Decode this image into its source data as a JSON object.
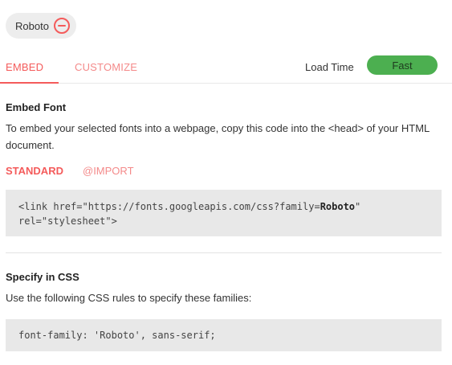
{
  "chip": {
    "label": "Roboto",
    "remove_icon": "minus-circle-icon"
  },
  "tabs": [
    {
      "label": "EMBED",
      "active": true
    },
    {
      "label": "CUSTOMIZE",
      "active": false
    }
  ],
  "load_time": {
    "label": "Load Time",
    "value": "Fast",
    "color": "#4caf50"
  },
  "embed": {
    "title": "Embed Font",
    "description": "To embed your selected fonts into a webpage, copy this code into the <head> of your HTML document.",
    "subtabs": [
      {
        "label": "STANDARD",
        "active": true
      },
      {
        "label": "@IMPORT",
        "active": false
      }
    ],
    "code_prefix": "<link href=\"https://fonts.googleapis.com/css?family=",
    "code_family": "Roboto",
    "code_suffix": "\" rel=\"stylesheet\">"
  },
  "css": {
    "title": "Specify in CSS",
    "description": "Use the following CSS rules to specify these families:",
    "code": "font-family: 'Roboto', sans-serif;"
  },
  "colors": {
    "accent": "#f45b5b",
    "accent_light": "#f48a8a",
    "code_bg": "#e8e8e8"
  }
}
